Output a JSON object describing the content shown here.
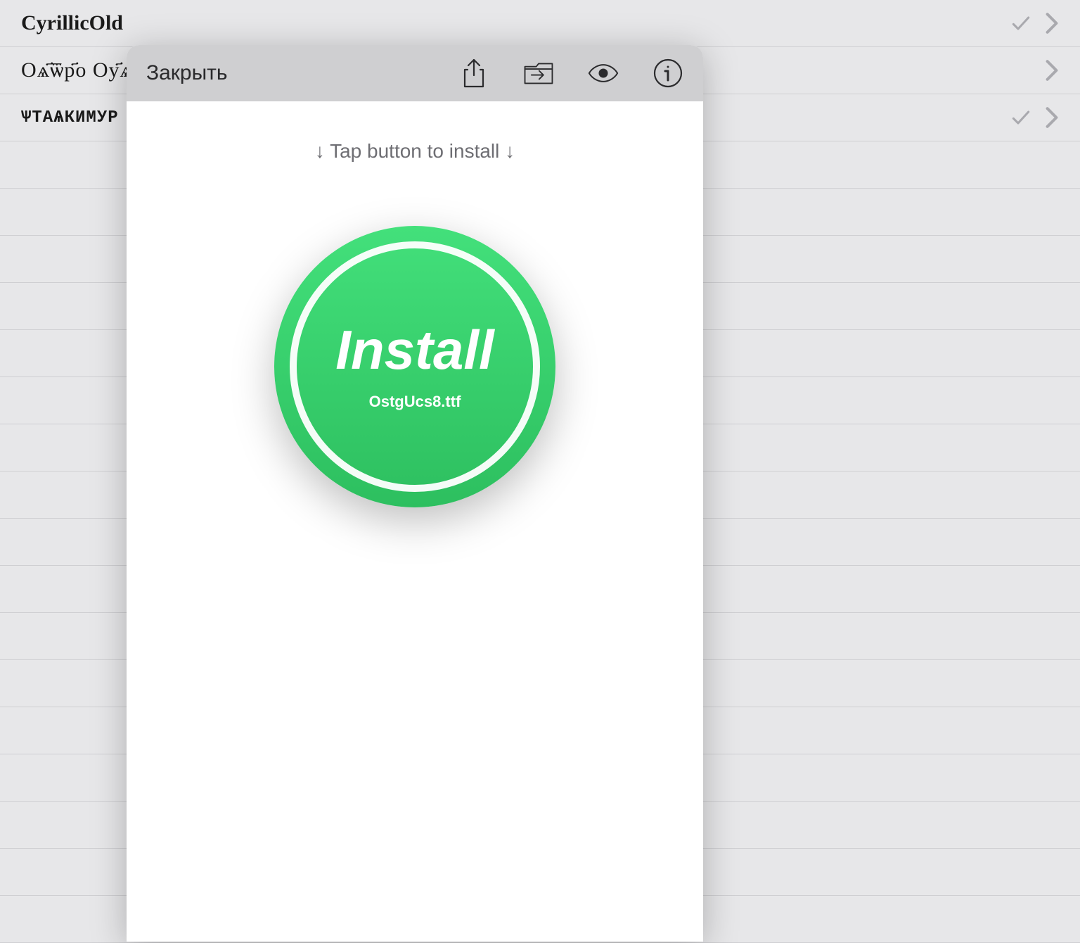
{
  "font_list": {
    "rows": [
      {
        "name": "CyrillicOld",
        "checked": true
      },
      {
        "name": "Оѧ҃ѿр҃о Оу҃ѧ҃",
        "checked": false
      },
      {
        "name": "ѱтаѧкимур ісоулз",
        "checked": true
      }
    ],
    "empty_rows": 16
  },
  "modal": {
    "close_label": "Закрыть",
    "instruction": "↓ Tap button to install ↓",
    "install_label": "Install",
    "install_file": "OstgUcs8.ttf"
  },
  "icons": {
    "check": "check-icon",
    "chevron": "chevron-right-icon",
    "share": "share-icon",
    "folder": "import-folder-icon",
    "eye": "eye-icon",
    "info": "info-icon"
  }
}
